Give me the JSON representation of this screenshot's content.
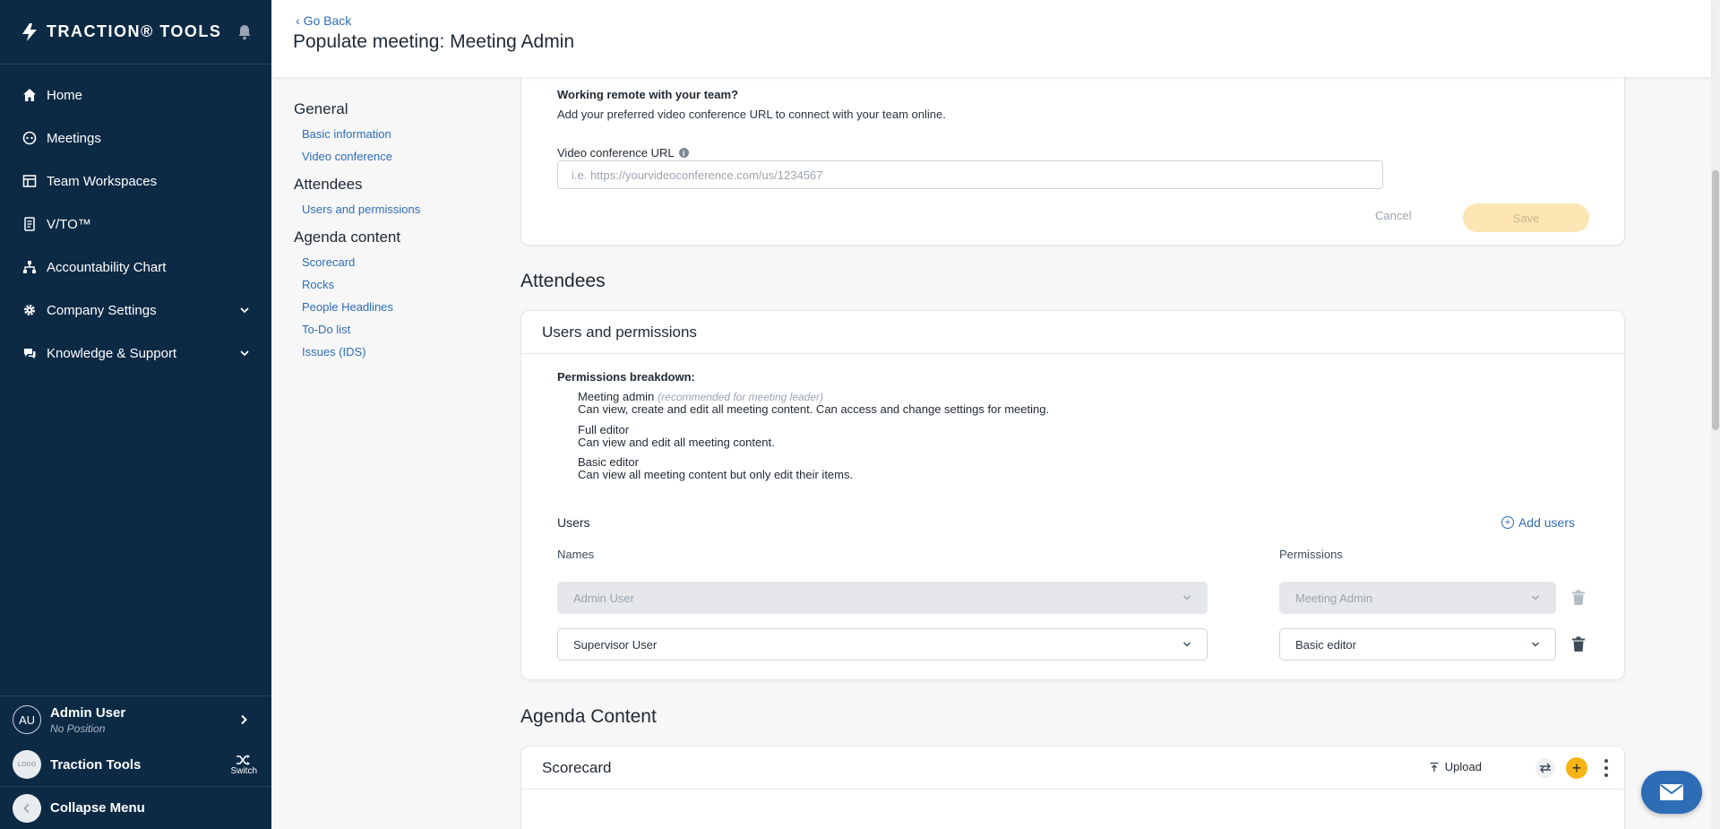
{
  "brand": {
    "name": "TRACTION® TOOLS"
  },
  "nav": {
    "items": [
      {
        "label": "Home",
        "icon": "home-icon"
      },
      {
        "label": "Meetings",
        "icon": "meetings-icon"
      },
      {
        "label": "Team Workspaces",
        "icon": "workspace-icon"
      },
      {
        "label": "V/TO™",
        "icon": "document-icon"
      },
      {
        "label": "Accountability Chart",
        "icon": "org-chart-icon"
      },
      {
        "label": "Company Settings",
        "icon": "gear-icon"
      },
      {
        "label": "Knowledge & Support",
        "icon": "support-icon"
      }
    ]
  },
  "user": {
    "initials": "AU",
    "name": "Admin User",
    "position": "No Position"
  },
  "org": {
    "logo_text": "LOGO",
    "name": "Traction Tools",
    "switch_label": "Switch"
  },
  "collapse_label": "Collapse Menu",
  "header": {
    "go_back": "Go Back",
    "title": "Populate meeting: Meeting Admin"
  },
  "local_nav": {
    "general": "General",
    "general_links": [
      "Basic information",
      "Video conference"
    ],
    "attendees": "Attendees",
    "attendees_links": [
      "Users and permissions"
    ],
    "agenda": "Agenda content",
    "agenda_links": [
      "Scorecard",
      "Rocks",
      "People Headlines",
      "To-Do list",
      "Issues (IDS)"
    ]
  },
  "video_conference": {
    "title": "Working remote with your team?",
    "description": "Add your preferred video conference URL to connect with your team online.",
    "label": "Video conference URL",
    "placeholder": "i.e. https://yourvideoconference.com/us/1234567",
    "cancel": "Cancel",
    "save": "Save"
  },
  "attendees": {
    "heading": "Attendees",
    "card_title": "Users and permissions",
    "breakdown_title": "Permissions breakdown:",
    "perms": [
      {
        "name": "Meeting admin",
        "note": "(recommended for meeting leader)",
        "desc": "Can view, create and edit all meeting content. Can access and change settings for meeting."
      },
      {
        "name": "Full editor",
        "desc": "Can view and edit all meeting content."
      },
      {
        "name": "Basic editor",
        "desc": "Can view all meeting content but only edit their items."
      }
    ],
    "users_label": "Users",
    "add_users": "Add users",
    "names_col": "Names",
    "permissions_col": "Permissions",
    "rows": [
      {
        "name": "Admin User",
        "permission": "Meeting Admin",
        "disabled": true
      },
      {
        "name": "Supervisor User",
        "permission": "Basic editor",
        "disabled": false
      }
    ]
  },
  "agenda": {
    "heading": "Agenda Content",
    "scorecard_title": "Scorecard",
    "upload": "Upload"
  },
  "colors": {
    "sidebar": "#0d2a45",
    "link": "#2d6db5",
    "accent": "#f6b416"
  }
}
